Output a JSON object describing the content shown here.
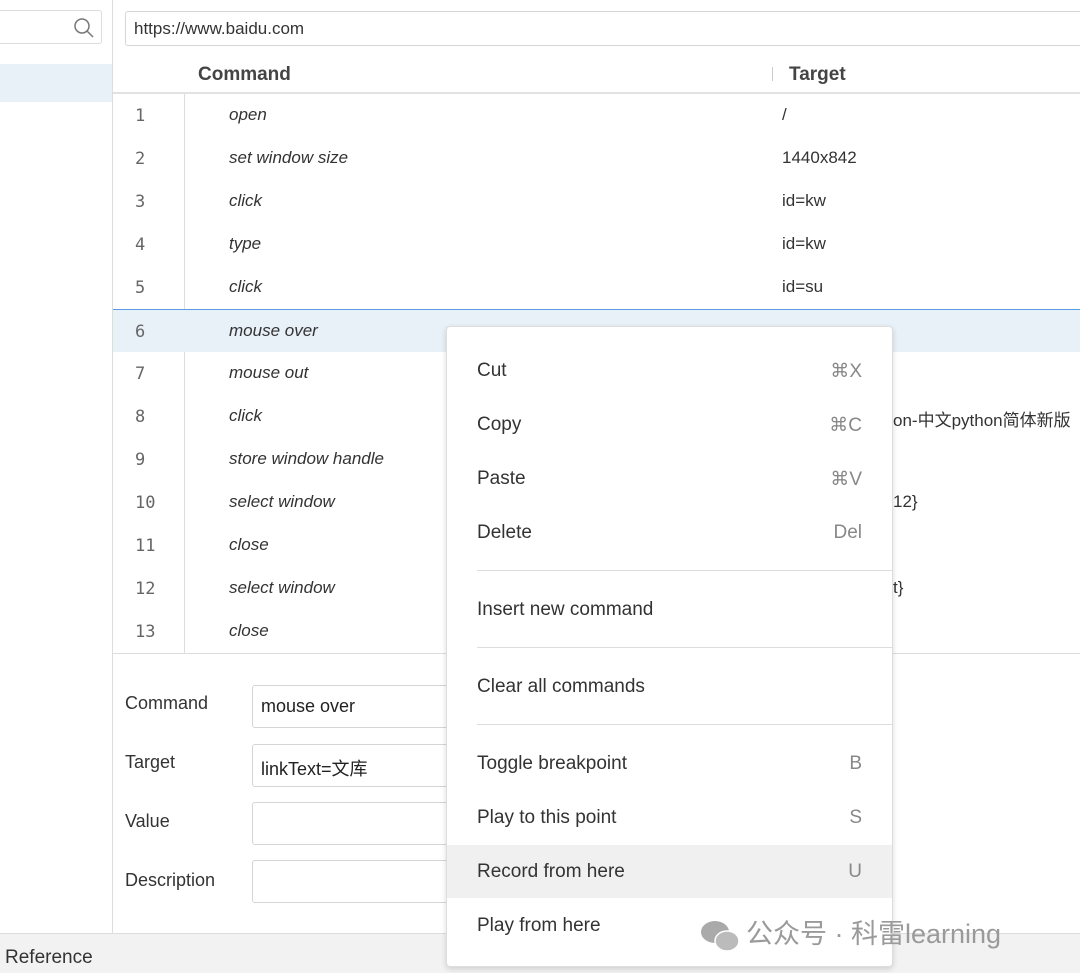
{
  "sidebar": {
    "search_icon": "search-icon"
  },
  "url": "https://www.baidu.com",
  "table": {
    "headers": [
      "Command",
      "Target"
    ],
    "rows": [
      {
        "n": "1",
        "command": "open",
        "target": "/"
      },
      {
        "n": "2",
        "command": "set window size",
        "target": "1440x842"
      },
      {
        "n": "3",
        "command": "click",
        "target": "id=kw"
      },
      {
        "n": "4",
        "command": "type",
        "target": "id=kw"
      },
      {
        "n": "5",
        "command": "click",
        "target": "id=su"
      },
      {
        "n": "6",
        "command": "mouse over",
        "target": "linkText=文库"
      },
      {
        "n": "7",
        "command": "mouse out",
        "target": ""
      },
      {
        "n": "8",
        "command": "click",
        "target": "on-中文python简体新版"
      },
      {
        "n": "9",
        "command": "store window handle",
        "target": ""
      },
      {
        "n": "10",
        "command": "select window",
        "target": "12}"
      },
      {
        "n": "11",
        "command": "close",
        "target": ""
      },
      {
        "n": "12",
        "command": "select window",
        "target": "t}"
      },
      {
        "n": "13",
        "command": "close",
        "target": ""
      }
    ],
    "selected_row": 6
  },
  "editor": {
    "command_label": "Command",
    "command_value": "mouse over",
    "target_label": "Target",
    "target_value": "linkText=文库",
    "value_label": "Value",
    "value_value": "",
    "description_label": "Description",
    "description_value": ""
  },
  "footer": {
    "reference": "Reference"
  },
  "menu": {
    "items": [
      {
        "label": "Cut",
        "key": "⌘X"
      },
      {
        "label": "Copy",
        "key": "⌘C"
      },
      {
        "label": "Paste",
        "key": "⌘V"
      },
      {
        "label": "Delete",
        "key": "Del"
      },
      {
        "label": "Insert new command",
        "key": ""
      },
      {
        "label": "Clear all commands",
        "key": ""
      },
      {
        "label": "Toggle breakpoint",
        "key": "B"
      },
      {
        "label": "Play to this point",
        "key": "S"
      },
      {
        "label": "Record from here",
        "key": "U"
      },
      {
        "label": "Play from here",
        "key": ""
      }
    ],
    "highlighted": "Record from here"
  },
  "watermark": "公众号 · 科雷learning",
  "colors": {
    "selection": "#e8f0f8",
    "selection_border": "#5b9be6",
    "menu_highlight": "#f0f0f0"
  }
}
